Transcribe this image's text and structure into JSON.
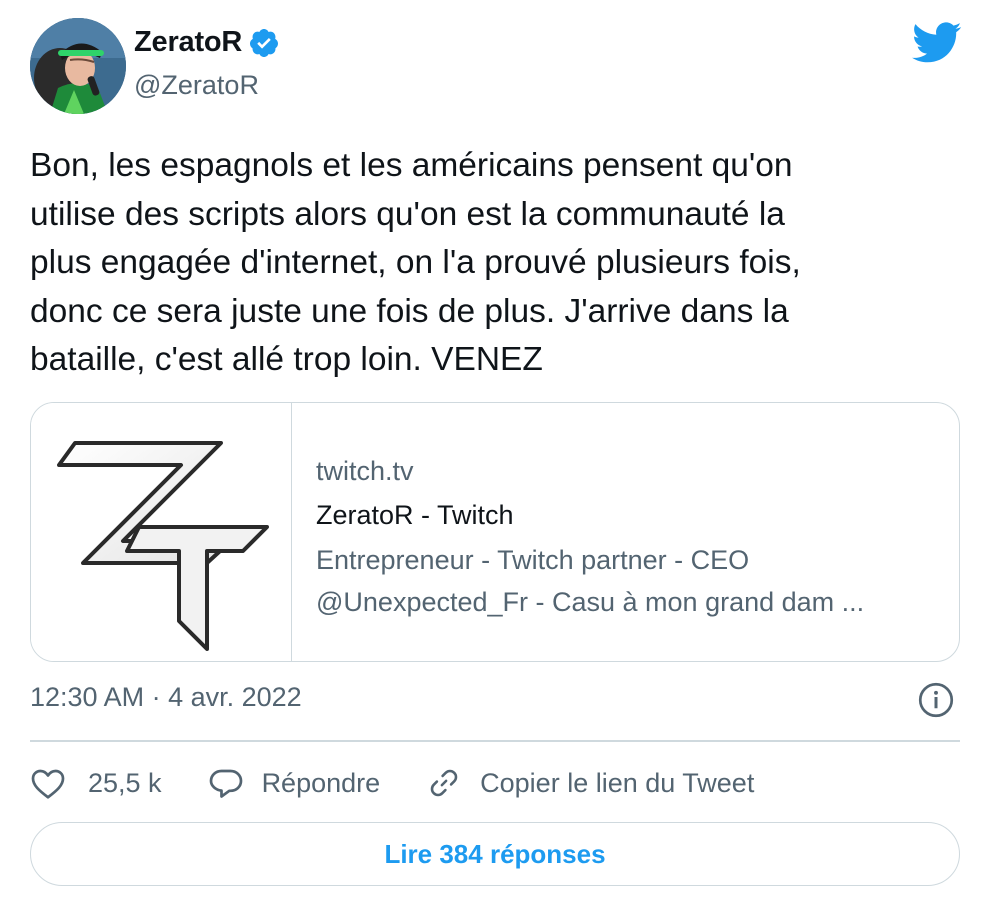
{
  "author": {
    "display_name": "ZeratoR",
    "handle": "@ZeratoR",
    "verified": true
  },
  "tweet": {
    "text": "Bon, les espagnols et les américains pensent qu'on\nutilise des scripts alors qu'on est la communauté la\nplus engagée d'internet, on l'a prouvé plusieurs fois,\ndonc ce sera juste une fois de plus. J'arrive dans la\nbataille, c'est allé trop loin. VENEZ",
    "time": "12:30 AM · 4 avr. 2022"
  },
  "card": {
    "domain": "twitch.tv",
    "title": "ZeratoR - Twitch",
    "description": "Entrepreneur - Twitch partner - CEO @Unexpected_Fr - Casu à mon grand dam ..."
  },
  "actions": {
    "likes": "25,5 k",
    "reply_label": "Répondre",
    "copy_link_label": "Copier le lien du Tweet"
  },
  "replies_button": "Lire 384 réponses",
  "icons": {
    "logo": "twitter-bird-icon",
    "verified": "verified-badge-icon",
    "info": "info-icon",
    "like": "heart-icon",
    "reply": "speech-bubble-icon",
    "copy": "link-icon"
  },
  "colors": {
    "accent": "#1d9bf0",
    "text": "#0f1419",
    "secondary": "#536471",
    "border": "#cfd9de"
  }
}
